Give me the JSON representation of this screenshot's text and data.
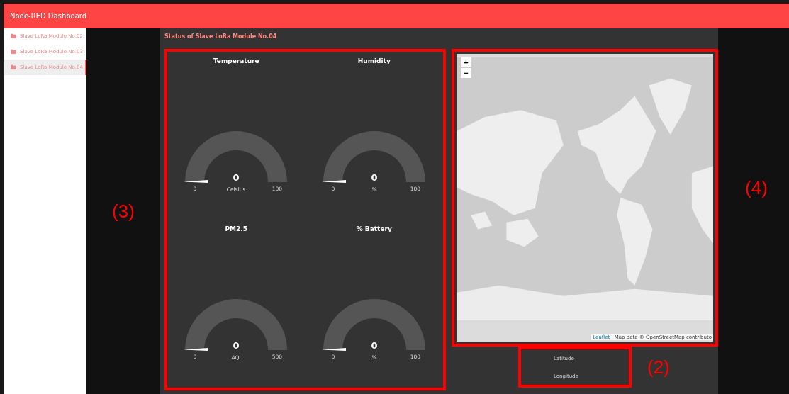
{
  "header": {
    "title": "Node-RED Dashboard"
  },
  "sidebar": {
    "items": [
      {
        "label": "Slave LoRa Module No.02",
        "selected": false
      },
      {
        "label": "Slave LoRa Module No.03",
        "selected": false
      },
      {
        "label": "Slave LoRa Module No.04",
        "selected": true
      }
    ]
  },
  "group": {
    "title": "Status of Slave LoRa Module No.04"
  },
  "gauges": [
    {
      "title": "Temperature",
      "value": "0",
      "units": "Celsius",
      "min": "0",
      "max": "100"
    },
    {
      "title": "Humidity",
      "value": "0",
      "units": "%",
      "min": "0",
      "max": "100"
    },
    {
      "title": "PM2.5",
      "value": "0",
      "units": "AQI",
      "min": "0",
      "max": "500"
    },
    {
      "title": "% Battery",
      "value": "0",
      "units": "%",
      "min": "0",
      "max": "100"
    }
  ],
  "map": {
    "zoom_in": "+",
    "zoom_out": "−",
    "attribution_link": "Leaflet",
    "attribution": "| Map data © OpenStreetMap contributo"
  },
  "location": {
    "fields": [
      "Latitude",
      "Longitude"
    ]
  },
  "annotations": {
    "gauges": "(3)",
    "map": "(4)",
    "location": "(2)"
  }
}
